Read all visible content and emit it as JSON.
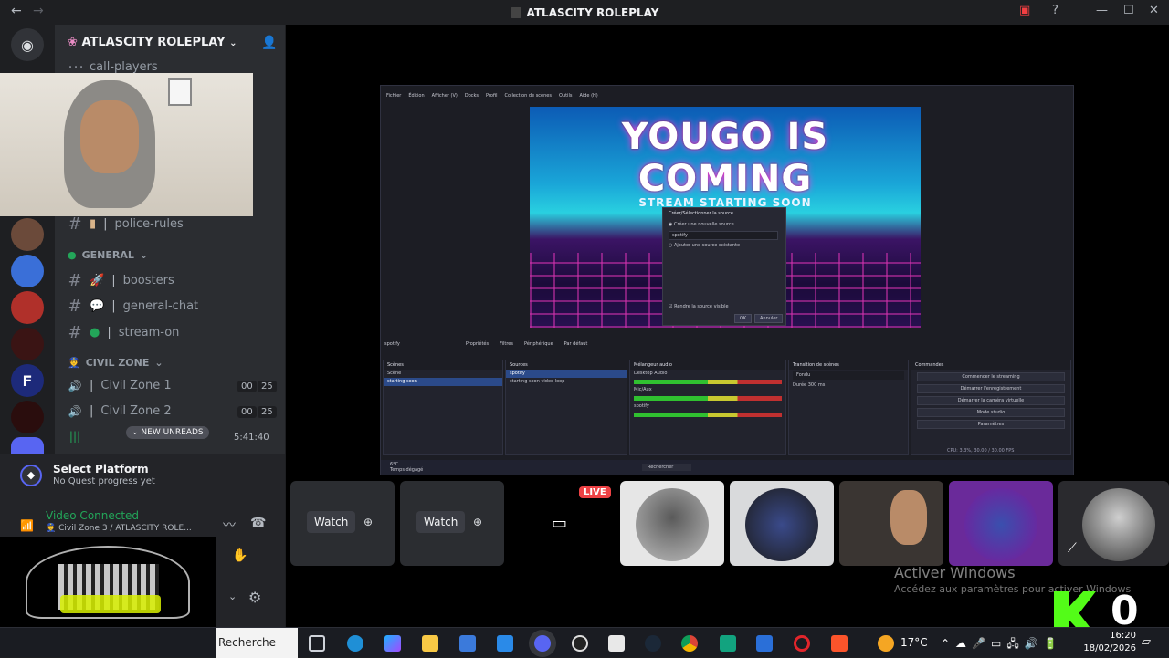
{
  "window": {
    "title": "ATLASCITY ROLEPLAY"
  },
  "server": {
    "name": "ATLASCITY ROLEPLAY"
  },
  "channels": {
    "top_partial": "call-players",
    "police_rules": "police-rules",
    "category_general": "GENERAL",
    "boosters": "boosters",
    "general_chat": "general-chat",
    "stream_on": "stream-on",
    "category_civil": "CIVIL ZONE",
    "civil1": {
      "name": "Civil Zone 1",
      "a": "00",
      "b": "25"
    },
    "civil2": {
      "name": "Civil Zone 2",
      "a": "00",
      "b": "25"
    },
    "civil3_timer": "5:41:40",
    "new_unreads": "NEW UNREADS"
  },
  "quest": {
    "title": "Select Platform",
    "subtitle": "No Quest progress yet"
  },
  "voice": {
    "status": "Video Connected",
    "location": "Civil Zone 3 / ATLASCITY ROLE..."
  },
  "obs": {
    "menu": [
      "Fichier",
      "Édition",
      "Afficher (V)",
      "Docks",
      "Profil",
      "Collection de scènes",
      "Outils",
      "Aide (H)"
    ],
    "headline": "YOUGO IS COMING",
    "subheadline": "STREAM STARTING SOON",
    "dialog": {
      "title": "Créer/Sélectionner la source",
      "opt_new": "Créer une nouvelle source",
      "value": "spotify",
      "opt_existing": "Ajouter une source existante",
      "visible": "Rendre la source visible",
      "ok": "OK",
      "cancel": "Annuler"
    },
    "source_selected": "spotify",
    "tabs": [
      "Propriétés",
      "Filtres",
      "Périphérique",
      "Par défaut"
    ],
    "scenes": {
      "header": "Scènes",
      "items": [
        "Scène",
        "starting soon"
      ]
    },
    "sources": {
      "header": "Sources",
      "items": [
        "spotify",
        "starting soon video loop"
      ]
    },
    "mixer": {
      "header": "Mélangeur audio",
      "items": [
        "Desktop Audio",
        "Mic/Aux",
        "spotify"
      ]
    },
    "transitions": {
      "header": "Transition de scènes",
      "type": "Fondu",
      "duration_label": "Durée",
      "duration": "300 ms"
    },
    "controls": {
      "header": "Commandes",
      "buttons": [
        "Commencer le streaming",
        "Démarrer l'enregistrement",
        "Démarrer la caméra virtuelle",
        "Mode studio",
        "Paramètres"
      ]
    },
    "status": "CPU: 3.3%, 30.00 / 30.00 FPS",
    "inner_taskbar": {
      "weather": "6°C",
      "weather_sub": "Temps dégagé",
      "search": "Rechercher"
    }
  },
  "stage": {
    "watch1": "Watch",
    "watch2": "Watch",
    "live": "LIVE"
  },
  "watermark": {
    "title": "Activer Windows",
    "subtitle": "Accédez aux paramètres pour activer Windows"
  },
  "overlay_digit": "0",
  "taskbar": {
    "search": "Recherche",
    "temp": "17°C",
    "time": "16:20",
    "date": "18/02/2026"
  },
  "colors": {
    "accent": "#5865f2",
    "online": "#23a559",
    "live": "#ed4245",
    "panel": "#2b2d31",
    "rail": "#1e1f22"
  }
}
